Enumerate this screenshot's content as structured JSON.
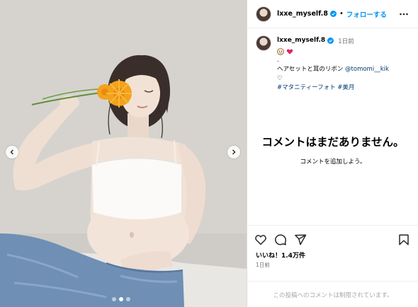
{
  "header": {
    "username": "lxxe_myself.8",
    "separator": "•",
    "follow_label": "フォローする"
  },
  "caption": {
    "username": "lxxe_myself.8",
    "time": "1日前",
    "dot_line": ".",
    "line1_text": "ヘアセットと耳のリボン ",
    "line1_mention": "@tomomi__kik",
    "heart_line": "♡",
    "hashtags": "#マタニティーフォト #美月"
  },
  "comments": {
    "empty_title": "コメントはまだありません。",
    "empty_sub": "コメントを追加しよう。"
  },
  "post": {
    "likes": "いいね！1.4万件",
    "time": "1日前",
    "comments_disabled": "この投稿へのコメントは制限されています。"
  },
  "carousel": {
    "slide_count": 3,
    "active_index": 1
  },
  "colors": {
    "follow_blue": "#0095f6",
    "link_navy": "#00376b",
    "muted_gray": "#737373",
    "verified_blue": "#0095f6",
    "flower_orange": "#f4a21c"
  },
  "icons": [
    "more-icon",
    "verified-badge-icon",
    "heart-icon",
    "comment-icon",
    "share-icon",
    "bookmark-icon",
    "chevron-left-icon",
    "chevron-right-icon"
  ]
}
